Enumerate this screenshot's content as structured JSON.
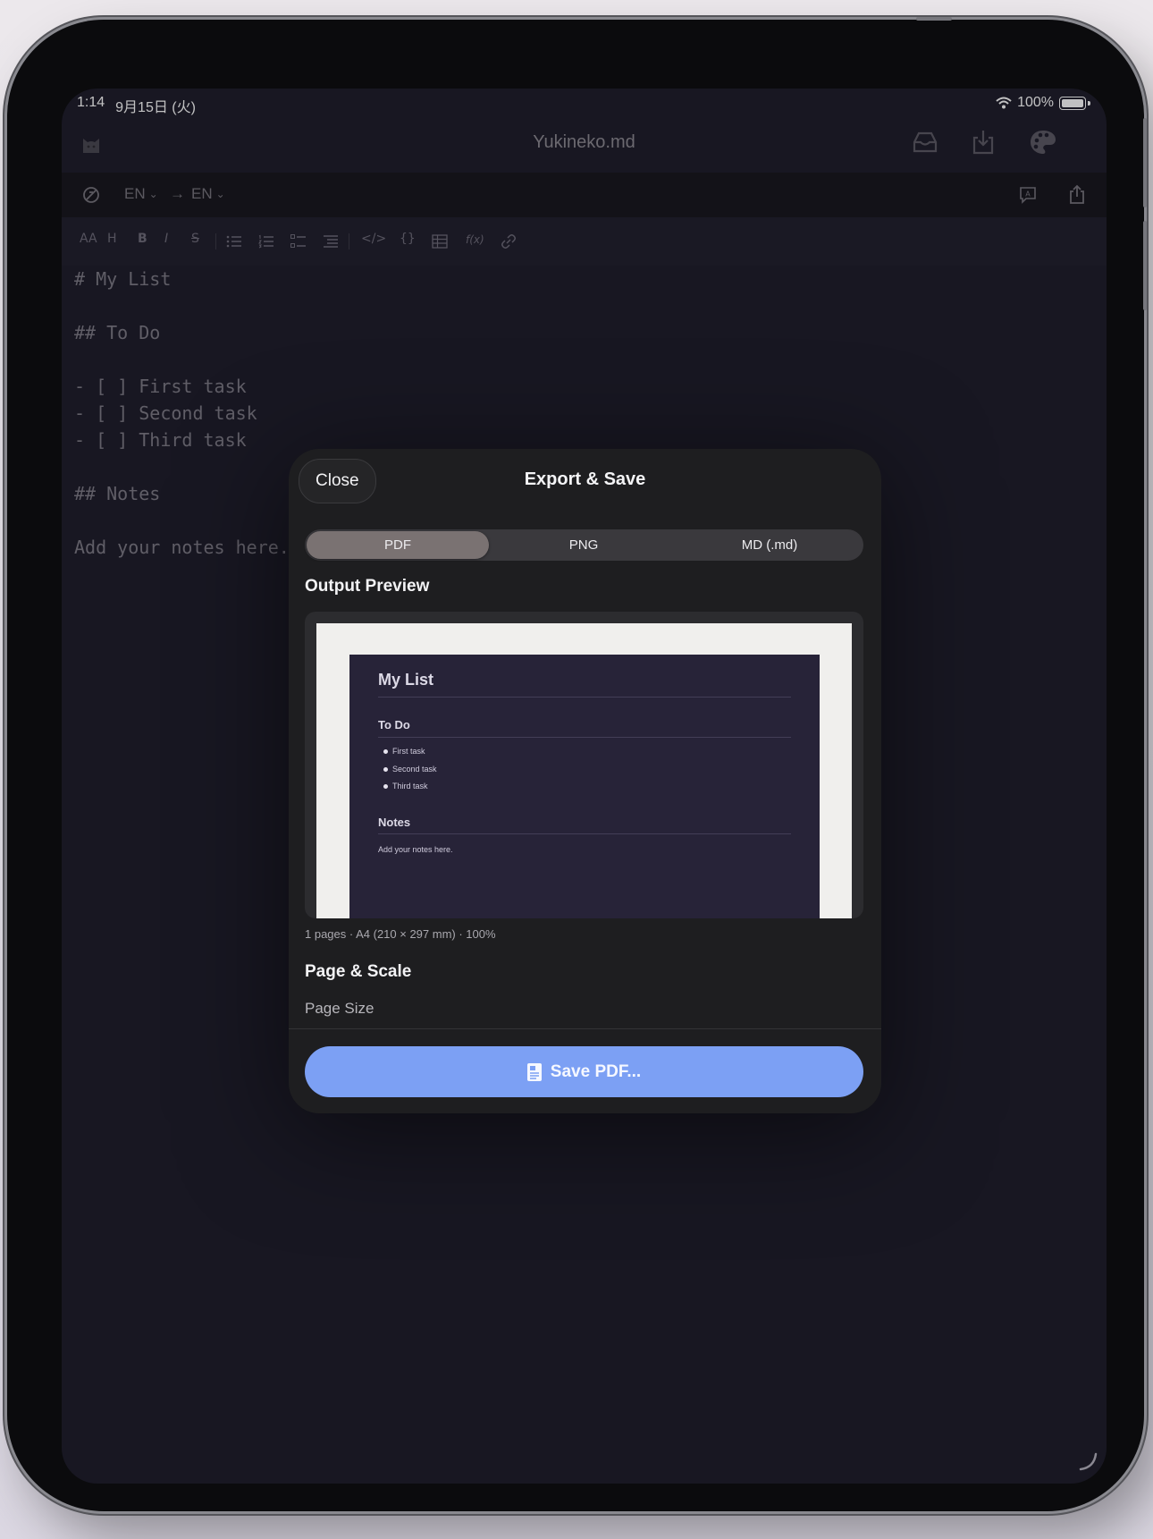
{
  "status_bar": {
    "time": "1:14",
    "date": "9月15日 (火)",
    "battery": "100%"
  },
  "nav": {
    "title": "Yukineko.md",
    "icons": [
      "cat-icon",
      "inbox-icon",
      "download-icon",
      "palette-icon"
    ]
  },
  "translate_bar": {
    "from_lang": "EN",
    "to_lang": "EN",
    "arrow": "→"
  },
  "format_bar": {
    "buttons": [
      "AA",
      "H",
      "B",
      "I",
      "S",
      "</>",
      "{}",
      "f(x)"
    ]
  },
  "editor": {
    "lines": [
      "# My List",
      "",
      "## To Do",
      "",
      "- [ ] First task",
      "- [ ] Second task",
      "- [ ] Third task",
      "",
      "## Notes",
      "",
      "Add your notes here."
    ]
  },
  "modal": {
    "close_label": "Close",
    "title": "Export & Save",
    "formats": [
      "PDF",
      "PNG",
      "MD (.md)"
    ],
    "selected_format": "PDF",
    "preview_heading": "Output Preview",
    "preview": {
      "title": "My List",
      "section1": "To Do",
      "tasks": [
        "First task",
        "Second task",
        "Third task"
      ],
      "section2": "Notes",
      "note": "Add your notes here."
    },
    "caption": "1 pages · A4 (210 × 297 mm) · 100%",
    "page_scale_heading": "Page & Scale",
    "page_size_label": "Page Size",
    "save_label": "Save PDF..."
  },
  "colors": {
    "accent": "#7ca0f4",
    "segment_active": "#7a7272",
    "editor_bg": "#1e1d2a"
  }
}
